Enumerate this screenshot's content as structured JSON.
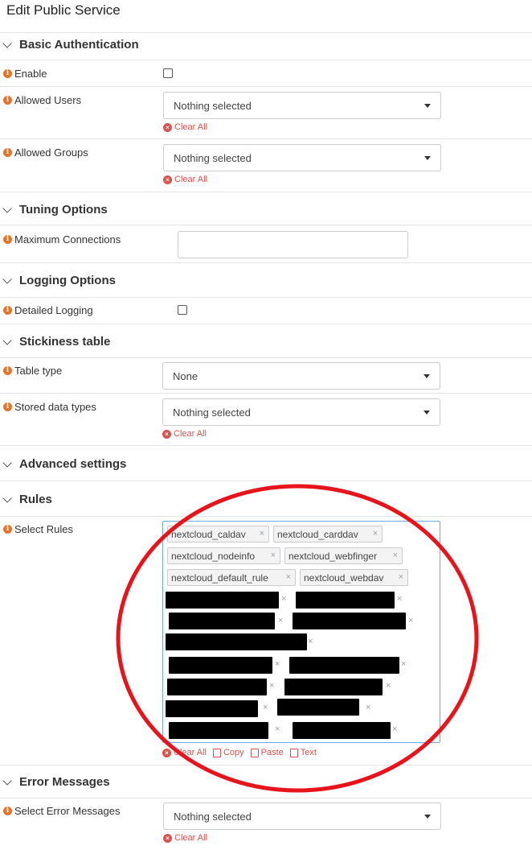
{
  "page_title": "Edit Public Service",
  "sections": {
    "basic_auth": "Basic Authentication",
    "tuning": "Tuning Options",
    "logging": "Logging Options",
    "stickiness": "Stickiness table",
    "advanced": "Advanced settings",
    "rules": "Rules",
    "error_messages": "Error Messages"
  },
  "fields": {
    "enable": {
      "label": "Enable",
      "checked": false
    },
    "allowed_users": {
      "label": "Allowed Users",
      "value": "Nothing selected",
      "clear": "Clear All"
    },
    "allowed_groups": {
      "label": "Allowed Groups",
      "value": "Nothing selected",
      "clear": "Clear All"
    },
    "max_connections": {
      "label": "Maximum Connections",
      "value": ""
    },
    "detailed_logging": {
      "label": "Detailed Logging",
      "checked": false
    },
    "table_type": {
      "label": "Table type",
      "value": "None"
    },
    "stored_data_types": {
      "label": "Stored data types",
      "value": "Nothing selected",
      "clear": "Clear All"
    },
    "select_rules": {
      "label": "Select Rules",
      "tags": [
        "nextcloud_caldav",
        "nextcloud_carddav",
        "nextcloud_nodeinfo",
        "nextcloud_webfinger",
        "nextcloud_default_rule",
        "nextcloud_webdav"
      ],
      "tools": {
        "clear": "Clear All",
        "copy": "Copy",
        "paste": "Paste",
        "text": "Text"
      }
    },
    "select_error_messages": {
      "label": "Select Error Messages",
      "value": "Nothing selected",
      "clear": "Clear All"
    }
  },
  "icons": {
    "info": "info-icon",
    "chevron": "chevron-down-icon",
    "clear": "x-circle-icon",
    "annotation": "red-ellipse-annotation"
  },
  "colors": {
    "info": "#e5732a",
    "danger": "#d9534f",
    "annotation": "#e8141c",
    "focus": "#6ea8dc"
  },
  "glyphs": {
    "info": "i",
    "x": "×",
    "clear": "×"
  }
}
